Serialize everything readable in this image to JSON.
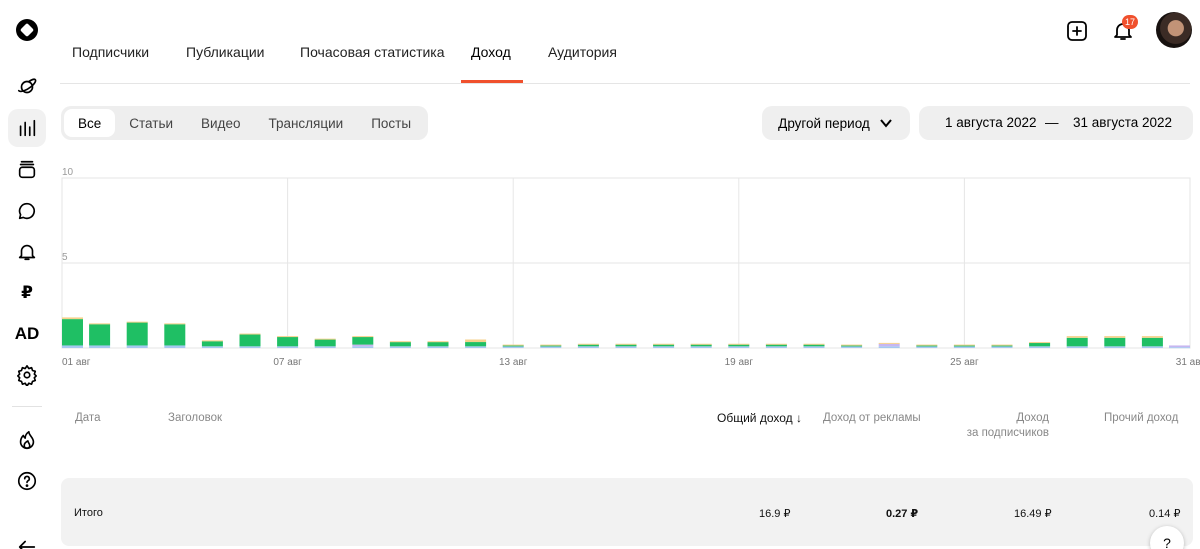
{
  "sidebar": {
    "items": [
      "planet-icon",
      "stats-icon",
      "feed-icon",
      "comments-icon",
      "notifications-icon",
      "ruble-icon",
      "ad-icon",
      "settings-icon",
      "fire-icon",
      "help-icon",
      "back-icon"
    ],
    "ruble_label": "₽",
    "ad_label": "AD",
    "active": "stats-icon"
  },
  "header": {
    "notifications_count": "17"
  },
  "tabs": [
    {
      "label": "Подписчики"
    },
    {
      "label": "Публикации"
    },
    {
      "label": "Почасовая статистика"
    },
    {
      "label": "Доход",
      "active": true
    },
    {
      "label": "Аудитория"
    }
  ],
  "filters": {
    "content_types": [
      "Все",
      "Статьи",
      "Видео",
      "Трансляции",
      "Посты"
    ],
    "selected": "Все",
    "period_label": "Другой период",
    "date_from": "1 августа 2022",
    "date_sep": "—",
    "date_to": "31 августа 2022"
  },
  "chart_data": {
    "type": "bar",
    "stacked": true,
    "ylim": [
      0,
      10
    ],
    "yticks": [
      "0",
      "5",
      "10"
    ],
    "xtick_labels": [
      "01 авг",
      "07 авг",
      "13 авг",
      "19 авг",
      "25 авг",
      "31 авг"
    ],
    "x": [
      1,
      2,
      3,
      4,
      5,
      6,
      7,
      8,
      9,
      10,
      11,
      12,
      13,
      14,
      15,
      16,
      17,
      18,
      19,
      20,
      21,
      22,
      23,
      24,
      25,
      26,
      27,
      28,
      29,
      30,
      31
    ],
    "series": [
      {
        "color": "#1fbf64",
        "values": [
          1.55,
          1.25,
          1.35,
          1.25,
          0.3,
          0.7,
          0.55,
          0.4,
          0.45,
          0.25,
          0.25,
          0.25,
          0.05,
          0.05,
          0.1,
          0.1,
          0.1,
          0.1,
          0.1,
          0.1,
          0.1,
          0.05,
          0.0,
          0.05,
          0.05,
          0.05,
          0.2,
          0.5,
          0.5,
          0.5,
          0.0
        ]
      },
      {
        "color": "#a6c8f0",
        "values": [
          0.15,
          0.15,
          0.15,
          0.15,
          0.1,
          0.1,
          0.1,
          0.1,
          0.1,
          0.1,
          0.1,
          0.1,
          0.1,
          0.1,
          0.1,
          0.1,
          0.1,
          0.1,
          0.1,
          0.1,
          0.1,
          0.1,
          0.1,
          0.1,
          0.1,
          0.1,
          0.1,
          0.1,
          0.1,
          0.1,
          0.05
        ]
      },
      {
        "color": "#c7b6f0",
        "values": [
          0.0,
          0.0,
          0.0,
          0.0,
          0.0,
          0.0,
          0.0,
          0.0,
          0.1,
          0.0,
          0.0,
          0.0,
          0.0,
          0.0,
          0.0,
          0.0,
          0.0,
          0.0,
          0.0,
          0.0,
          0.0,
          0.0,
          0.15,
          0.0,
          0.0,
          0.0,
          0.0,
          0.0,
          0.0,
          0.0,
          0.1
        ]
      },
      {
        "color": "#f5d28c",
        "values": [
          0.1,
          0.05,
          0.05,
          0.05,
          0.05,
          0.05,
          0.05,
          0.05,
          0.05,
          0.05,
          0.05,
          0.15,
          0.05,
          0.05,
          0.05,
          0.05,
          0.05,
          0.05,
          0.05,
          0.05,
          0.05,
          0.05,
          0.05,
          0.05,
          0.05,
          0.05,
          0.05,
          0.1,
          0.1,
          0.1,
          0.0
        ]
      }
    ],
    "grid": true
  },
  "table": {
    "headers": {
      "date": "Дата",
      "title": "Заголовок",
      "total": "Общий доход",
      "ads": "Доход от рекламы",
      "subs_line1": "Доход",
      "subs_line2": "за подписчиков",
      "other": "Прочий доход"
    },
    "total_row": {
      "label": "Итого",
      "total": "16.9 ₽",
      "ads": "0.27 ₽",
      "subs": "16.49 ₽",
      "other": "0.14 ₽"
    }
  },
  "help_fab_label": "?"
}
